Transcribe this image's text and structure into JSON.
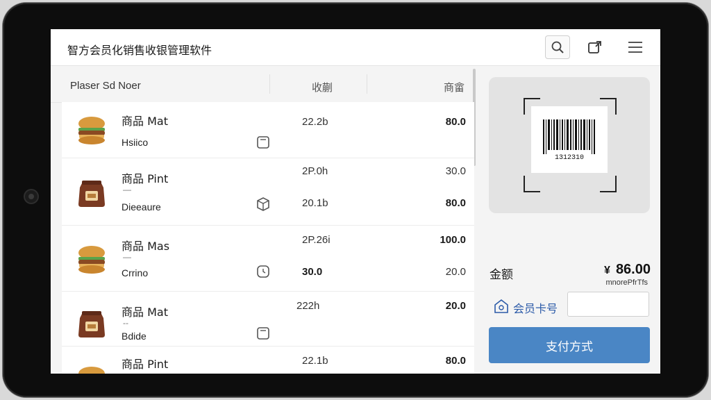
{
  "app": {
    "title": "智方会员化销售收银管理软件"
  },
  "header": {
    "icons": [
      "search-icon",
      "share-icon",
      "menu-icon"
    ]
  },
  "table": {
    "columns": [
      "Plaser Sd Noer",
      "收蒯",
      "商畲"
    ],
    "rows": [
      {
        "name": "商品 Mat",
        "sub": "Hsiico",
        "amount_top": "22.2b",
        "amount_bottom": "",
        "num_top": "80.0",
        "num_bottom": "",
        "thumb": "burger-icon"
      },
      {
        "name": "商品 Pint",
        "sub": "Dieeaure",
        "amount_top": "2P.0h",
        "amount_bottom": "20.1b",
        "num_top": "30.0",
        "num_bottom": "80.0",
        "thumb": "sack-icon"
      },
      {
        "name": "商品 Mas",
        "sub": "Crrino",
        "amount_top": "2P.26i",
        "amount_bottom": "30.0",
        "num_top": "100.0",
        "num_bottom": "20.0",
        "thumb": "burger-icon"
      },
      {
        "name": "商品 Mat",
        "sub": "Bdide",
        "amount_top": "222h",
        "amount_bottom": "",
        "num_top": "20.0",
        "num_bottom": "",
        "thumb": "sack-icon"
      },
      {
        "name": "商品 Pint",
        "sub": "",
        "amount_top": "22.1b",
        "amount_bottom": "",
        "num_top": "80.0",
        "num_bottom": "",
        "thumb": "burger-icon"
      }
    ]
  },
  "checkout": {
    "barcode_text": "1312310",
    "amount_label": "金额",
    "amount_value": "86.00",
    "amount_note": "mnorePfrTfs",
    "member_label": "会员卡号",
    "member_value": "",
    "pay_label": "支付方式"
  },
  "colors": {
    "accent": "#4a86c5",
    "member_text": "#2b5aa8"
  }
}
